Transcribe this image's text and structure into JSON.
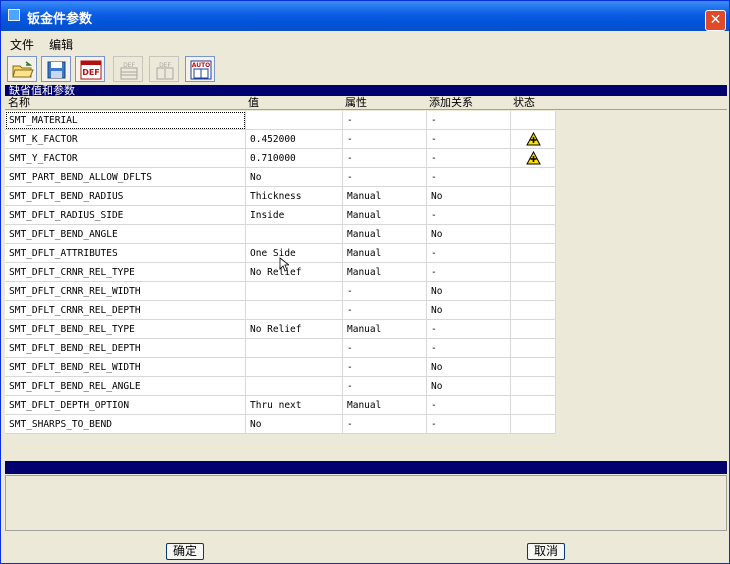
{
  "window": {
    "title": "钣金件参数",
    "close_glyph": "✕"
  },
  "menu": {
    "items": [
      "文件",
      "编辑"
    ]
  },
  "toolbar": {
    "buttons": [
      {
        "icon": "open-folder-icon",
        "enabled": true
      },
      {
        "icon": "save-icon",
        "enabled": true
      },
      {
        "icon": "def-icon",
        "enabled": true,
        "text": "DEF"
      },
      {
        "icon": "def-export-icon",
        "enabled": false,
        "text": "DEF"
      },
      {
        "icon": "def-import-icon",
        "enabled": false,
        "text": "DEF"
      },
      {
        "icon": "auto-icon",
        "enabled": true,
        "text": "AUTO"
      }
    ]
  },
  "section_title": "缺省值和参数",
  "columns": [
    "名称",
    "值",
    "属性",
    "添加关系",
    "状态"
  ],
  "rows": [
    {
      "name": "SMT_MATERIAL",
      "value": "",
      "attr": "-",
      "relation": "-",
      "status": ""
    },
    {
      "name": "SMT_K_FACTOR",
      "value": "0.452000",
      "attr": "-",
      "relation": "-",
      "status": "warning"
    },
    {
      "name": "SMT_Y_FACTOR",
      "value": "0.710000",
      "attr": "-",
      "relation": "-",
      "status": "warning"
    },
    {
      "name": "SMT_PART_BEND_ALLOW_DFLTS",
      "value": "No",
      "attr": "-",
      "relation": "-",
      "status": ""
    },
    {
      "name": "SMT_DFLT_BEND_RADIUS",
      "value": "Thickness",
      "attr": "Manual",
      "relation": "No",
      "status": ""
    },
    {
      "name": "SMT_DFLT_RADIUS_SIDE",
      "value": "Inside",
      "attr": "Manual",
      "relation": "-",
      "status": ""
    },
    {
      "name": "SMT_DFLT_BEND_ANGLE",
      "value": "",
      "attr": "Manual",
      "relation": "No",
      "status": ""
    },
    {
      "name": "SMT_DFLT_ATTRIBUTES",
      "value": "One Side",
      "attr": "Manual",
      "relation": "-",
      "status": ""
    },
    {
      "name": "SMT_DFLT_CRNR_REL_TYPE",
      "value": "No Relief",
      "attr": "Manual",
      "relation": "-",
      "status": ""
    },
    {
      "name": "SMT_DFLT_CRNR_REL_WIDTH",
      "value": "",
      "attr": "-",
      "relation": "No",
      "status": ""
    },
    {
      "name": "SMT_DFLT_CRNR_REL_DEPTH",
      "value": "",
      "attr": "-",
      "relation": "No",
      "status": ""
    },
    {
      "name": "SMT_DFLT_BEND_REL_TYPE",
      "value": "No Relief",
      "attr": "Manual",
      "relation": "-",
      "status": ""
    },
    {
      "name": "SMT_DFLT_BEND_REL_DEPTH",
      "value": "",
      "attr": "-",
      "relation": "-",
      "status": ""
    },
    {
      "name": "SMT_DFLT_BEND_REL_WIDTH",
      "value": "",
      "attr": "-",
      "relation": "No",
      "status": ""
    },
    {
      "name": "SMT_DFLT_BEND_REL_ANGLE",
      "value": "",
      "attr": "-",
      "relation": "No",
      "status": ""
    },
    {
      "name": "SMT_DFLT_DEPTH_OPTION",
      "value": "Thru next",
      "attr": "Manual",
      "relation": "-",
      "status": ""
    },
    {
      "name": "SMT_SHARPS_TO_BEND",
      "value": "No",
      "attr": "-",
      "relation": "-",
      "status": ""
    }
  ],
  "buttons": {
    "ok": "确定",
    "cancel": "取消"
  },
  "colors": {
    "title_bar": "#0a5ce3",
    "section_bar": "#00006e",
    "dialog_bg": "#ece9d8",
    "warning": "#ffe000"
  }
}
